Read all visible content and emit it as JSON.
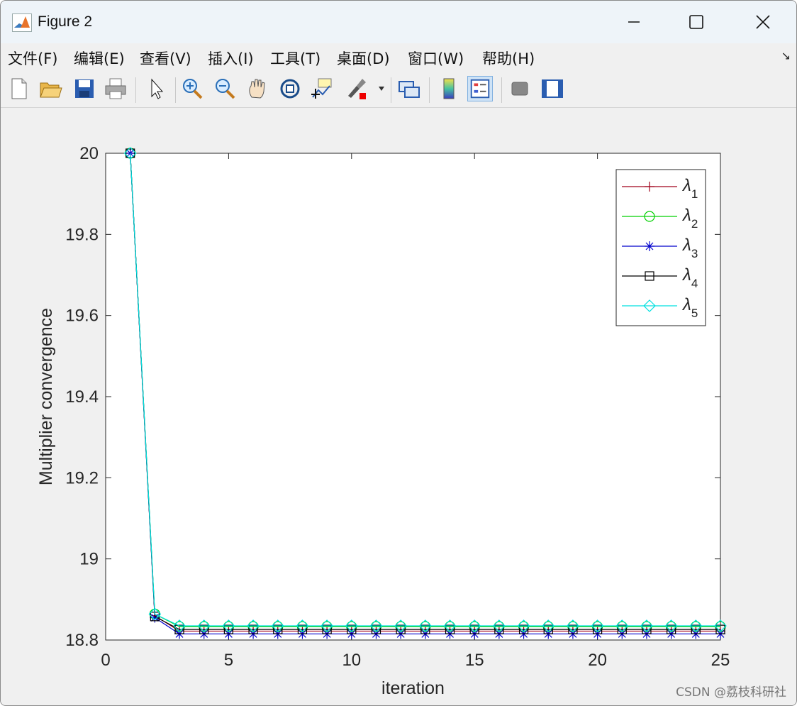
{
  "window": {
    "title": "Figure 2",
    "minimize_icon": "minimize-icon",
    "maximize_icon": "maximize-icon",
    "close_icon": "close-icon"
  },
  "menu": {
    "items": [
      "文件(F)",
      "编辑(E)",
      "查看(V)",
      "插入(I)",
      "工具(T)",
      "桌面(D)",
      "窗口(W)",
      "帮助(H)"
    ],
    "overflow_icon": "dock-arrow-icon"
  },
  "toolbar": {
    "buttons": [
      "new-figure-icon",
      "open-icon",
      "save-icon",
      "print-icon",
      "edit-plot-icon",
      "zoom-in-icon",
      "zoom-out-icon",
      "pan-icon",
      "rotate-3d-icon",
      "data-cursor-icon",
      "brush-icon",
      "link-plot-icon",
      "colorbar-icon",
      "legend-icon",
      "hide-plot-tools-icon",
      "show-plot-tools-icon"
    ]
  },
  "chart_data": {
    "type": "line",
    "title": "",
    "xlabel": "iteration",
    "ylabel": "Multiplier convergence",
    "xlim": [
      0,
      25
    ],
    "ylim": [
      18.8,
      20
    ],
    "xticks": [
      0,
      5,
      10,
      15,
      20,
      25
    ],
    "yticks": [
      18.8,
      19,
      19.2,
      19.4,
      19.6,
      19.8,
      20
    ],
    "ytick_labels": [
      "18.8",
      "19",
      "19.2",
      "19.4",
      "19.6",
      "19.8",
      "20"
    ],
    "grid": false,
    "legend_position": "top-right",
    "x": [
      1,
      2,
      3,
      4,
      5,
      6,
      7,
      8,
      9,
      10,
      11,
      12,
      13,
      14,
      15,
      16,
      17,
      18,
      19,
      20,
      21,
      22,
      23,
      24,
      25
    ],
    "series": [
      {
        "name": "λ1",
        "sub": "1",
        "color": "#a0001a",
        "marker": "plus",
        "values": [
          20,
          18.86,
          18.822,
          18.822,
          18.822,
          18.822,
          18.822,
          18.822,
          18.822,
          18.822,
          18.822,
          18.822,
          18.822,
          18.822,
          18.822,
          18.822,
          18.822,
          18.822,
          18.822,
          18.822,
          18.822,
          18.822,
          18.822,
          18.822,
          18.822
        ]
      },
      {
        "name": "λ2",
        "sub": "2",
        "color": "#00d000",
        "marker": "circle",
        "values": [
          20,
          18.864,
          18.833,
          18.833,
          18.833,
          18.833,
          18.833,
          18.833,
          18.833,
          18.833,
          18.833,
          18.833,
          18.833,
          18.833,
          18.833,
          18.833,
          18.833,
          18.833,
          18.833,
          18.833,
          18.833,
          18.833,
          18.833,
          18.833,
          18.833
        ]
      },
      {
        "name": "λ3",
        "sub": "3",
        "color": "#0000cc",
        "marker": "star",
        "values": [
          20,
          18.855,
          18.815,
          18.815,
          18.815,
          18.815,
          18.815,
          18.815,
          18.815,
          18.815,
          18.815,
          18.815,
          18.815,
          18.815,
          18.815,
          18.815,
          18.815,
          18.815,
          18.815,
          18.815,
          18.815,
          18.815,
          18.815,
          18.815,
          18.815
        ]
      },
      {
        "name": "λ4",
        "sub": "4",
        "color": "#000000",
        "marker": "square",
        "values": [
          20,
          18.858,
          18.826,
          18.826,
          18.826,
          18.826,
          18.826,
          18.826,
          18.826,
          18.826,
          18.826,
          18.826,
          18.826,
          18.826,
          18.826,
          18.826,
          18.826,
          18.826,
          18.826,
          18.826,
          18.826,
          18.826,
          18.826,
          18.826,
          18.826
        ]
      },
      {
        "name": "λ5",
        "sub": "5",
        "color": "#00e0e0",
        "marker": "diamond",
        "values": [
          20,
          18.864,
          18.835,
          18.835,
          18.835,
          18.835,
          18.835,
          18.835,
          18.835,
          18.835,
          18.835,
          18.835,
          18.835,
          18.835,
          18.835,
          18.835,
          18.835,
          18.835,
          18.835,
          18.835,
          18.835,
          18.835,
          18.835,
          18.835,
          18.835
        ]
      }
    ]
  },
  "watermark": "CSDN @荔枝科研社"
}
